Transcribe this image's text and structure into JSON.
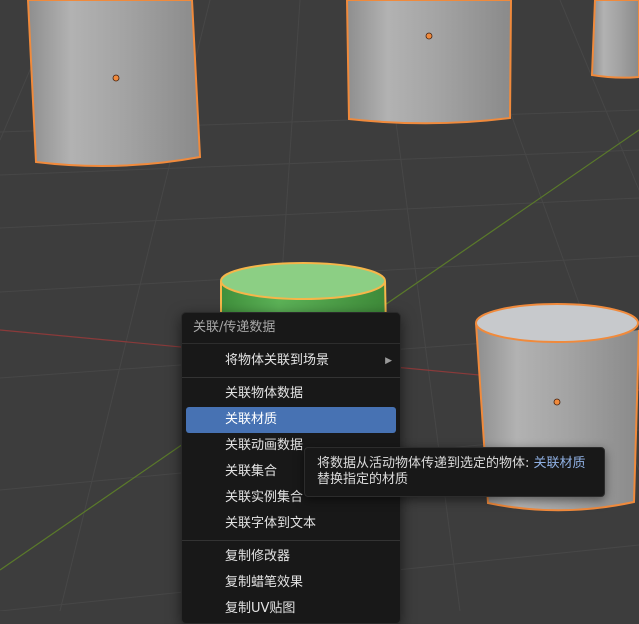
{
  "menu": {
    "title": "关联/传递数据",
    "items": [
      {
        "label": "将物体关联到场景",
        "submenu_indicator": "▶"
      },
      {
        "label": "关联物体数据"
      },
      {
        "label": "关联材质"
      },
      {
        "label": "关联动画数据"
      },
      {
        "label": "关联集合"
      },
      {
        "label": "关联实例集合"
      },
      {
        "label": "关联字体到文本"
      },
      {
        "label": "复制修改器"
      },
      {
        "label": "复制蜡笔效果"
      },
      {
        "label": "复制UV贴图"
      }
    ]
  },
  "tooltip": {
    "text": "将数据从活动物体传递到选定的物体:",
    "highlight": "关联材质",
    "description": "替换指定的材质"
  },
  "colors": {
    "viewport_bg": "#3d3d3d",
    "selection_outline": "#f08a3c",
    "menu_highlight": "#4772b3",
    "active_object": "#5fb55a"
  }
}
